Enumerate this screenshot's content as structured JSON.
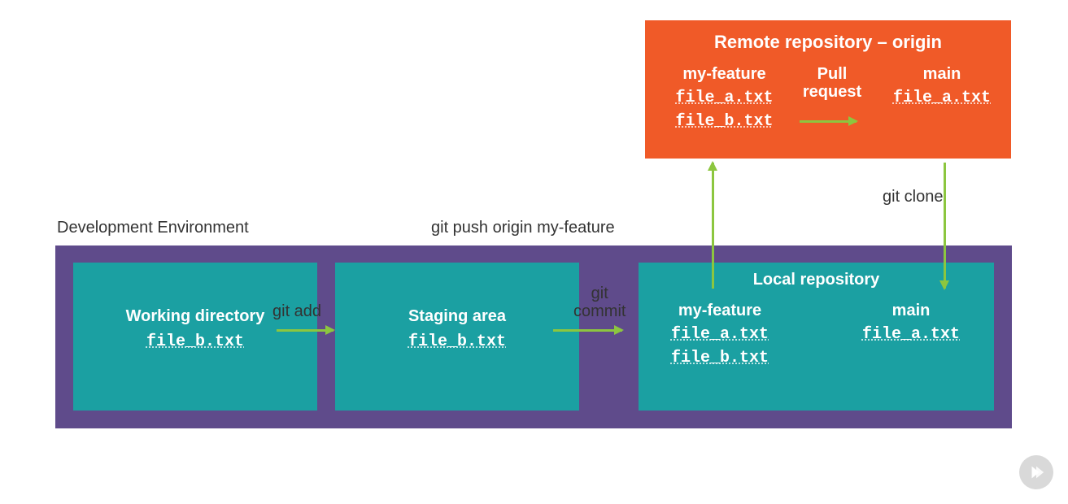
{
  "remote": {
    "title": "Remote repository – origin",
    "branch_feature": "my-feature",
    "branch_main": "main",
    "pull_request": "Pull request",
    "feature_files": [
      "file_a.txt",
      "file_b.txt"
    ],
    "main_files": [
      "file_a.txt"
    ]
  },
  "labels": {
    "dev_env": "Development Environment",
    "git_push": "git push origin my-feature",
    "git_clone": "git clone",
    "git_add": "git add",
    "git_commit": "git commit"
  },
  "working_dir": {
    "title": "Working directory",
    "files": [
      "file_b.txt"
    ]
  },
  "staging": {
    "title": "Staging area",
    "files": [
      "file_b.txt"
    ]
  },
  "local": {
    "title": "Local repository",
    "branch_feature": "my-feature",
    "branch_main": "main",
    "feature_files": [
      "file_a.txt",
      "file_b.txt"
    ],
    "main_files": [
      "file_a.txt"
    ]
  },
  "colors": {
    "orange": "#f05a28",
    "purple": "#5f4b8b",
    "teal": "#1ba0a2",
    "green": "#8cc63f"
  }
}
